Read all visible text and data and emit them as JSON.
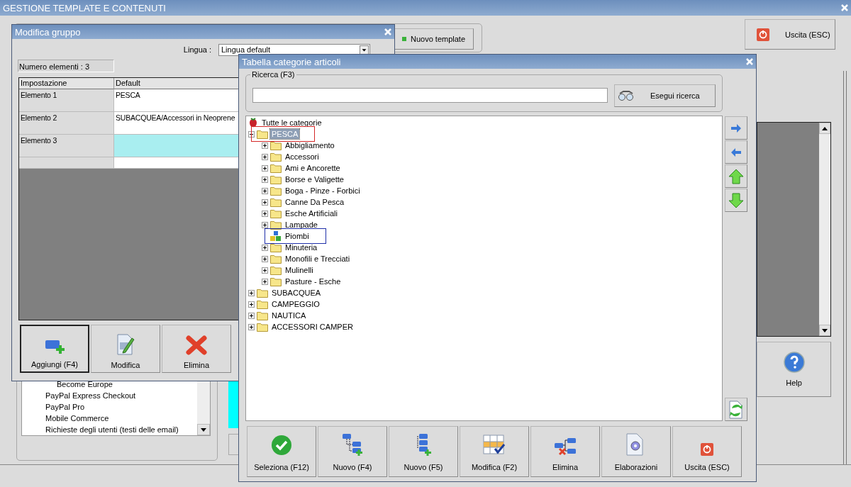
{
  "main_window": {
    "title": "GESTIONE TEMPLATE E CONTENUTI",
    "new_template_button": "Nuovo template",
    "exit_button": "Uscita (ESC)",
    "help_button": "Help",
    "template_list": [
      {
        "children": [
          {
            "label": "Become Europe"
          }
        ]
      },
      {
        "label": "PayPal Express Checkout"
      },
      {
        "label": "PayPal Pro"
      },
      {
        "label": "Mobile Commerce"
      },
      {
        "label": "Richieste degli utenti (testi delle email)"
      }
    ]
  },
  "modifica_gruppo": {
    "title": "Modifica gruppo",
    "language_label": "Lingua :",
    "language_value": "Lingua default",
    "count": "Numero elementi : 3",
    "columns": [
      "Impostazione",
      "Default"
    ],
    "rows": [
      {
        "setting": "Elemento 1",
        "value": "PESCA",
        "selected": false
      },
      {
        "setting": "Elemento 2",
        "value": "SUBACQUEA/Accessori in Neoprene",
        "selected": false
      },
      {
        "setting": "Elemento 3",
        "selected": true
      }
    ],
    "buttons": [
      {
        "label": "Aggiungi (F4)",
        "kind": "add",
        "focused": true
      },
      {
        "label": "Modifica",
        "kind": "edit",
        "focused": false
      },
      {
        "label": "Elimina",
        "kind": "delete",
        "focused": false
      }
    ]
  },
  "tabella": {
    "title": "Tabella categorie articoli",
    "search_label": "Ricerca (F3)",
    "search_button": "Esegui ricerca",
    "tree": {
      "label": "Tutte le categorie",
      "kind": "root",
      "children": [
        {
          "label": "PESCA",
          "kind": "folder",
          "expanded": true,
          "selected": true,
          "color": "#d42828",
          "children": [
            {
              "label": "Abbigliamento",
              "kind": "folder",
              "expanded": false,
              "selected": false
            },
            {
              "label": "Accessori",
              "kind": "folder",
              "expanded": false,
              "selected": false
            },
            {
              "label": "Ami e Ancorette",
              "kind": "folder",
              "expanded": false,
              "selected": false
            },
            {
              "label": "Borse e Valigette",
              "kind": "folder",
              "expanded": false,
              "selected": false
            },
            {
              "label": "Boga - Pinze - Forbici",
              "kind": "folder",
              "expanded": false,
              "selected": false
            },
            {
              "label": "Canne Da Pesca",
              "kind": "folder",
              "expanded": false,
              "selected": false
            },
            {
              "label": "Esche Artificiali",
              "kind": "folder",
              "expanded": false,
              "selected": false
            },
            {
              "label": "Lampade",
              "kind": "folder",
              "expanded": false,
              "selected": false
            },
            {
              "label": "Piombi",
              "kind": "item",
              "selected": false,
              "color": "#1f2fa8"
            },
            {
              "label": "Minuteria",
              "kind": "folder",
              "expanded": false,
              "selected": false
            },
            {
              "label": "Monofili e Trecciati",
              "kind": "folder",
              "expanded": false,
              "selected": false
            },
            {
              "label": "Mulinelli",
              "kind": "folder",
              "expanded": false,
              "selected": false
            },
            {
              "label": "Pasture - Esche",
              "kind": "folder",
              "expanded": false,
              "selected": false
            }
          ]
        },
        {
          "label": "SUBACQUEA",
          "kind": "folder",
          "expanded": false,
          "selected": false
        },
        {
          "label": "CAMPEGGIO",
          "kind": "folder",
          "expanded": false,
          "selected": false
        },
        {
          "label": "NAUTICA",
          "kind": "folder",
          "expanded": false,
          "selected": false
        },
        {
          "label": "ACCESSORI CAMPER",
          "kind": "folder",
          "expanded": false,
          "selected": false
        }
      ]
    },
    "side_buttons": [
      {
        "kind": "right"
      },
      {
        "kind": "left"
      },
      {
        "kind": "up"
      },
      {
        "kind": "down"
      }
    ],
    "toolbar": [
      {
        "label": "Seleziona (F12)",
        "kind": "select"
      },
      {
        "label": "Nuovo (F4)",
        "kind": "new-child"
      },
      {
        "label": "Nuovo (F5)",
        "kind": "new-sibling"
      },
      {
        "label": "Modifica (F2)",
        "kind": "edit"
      },
      {
        "label": "Elimina",
        "kind": "delete"
      },
      {
        "label": "Elaborazioni",
        "kind": "process"
      },
      {
        "label": "Uscita (ESC)",
        "kind": "exit"
      }
    ]
  }
}
